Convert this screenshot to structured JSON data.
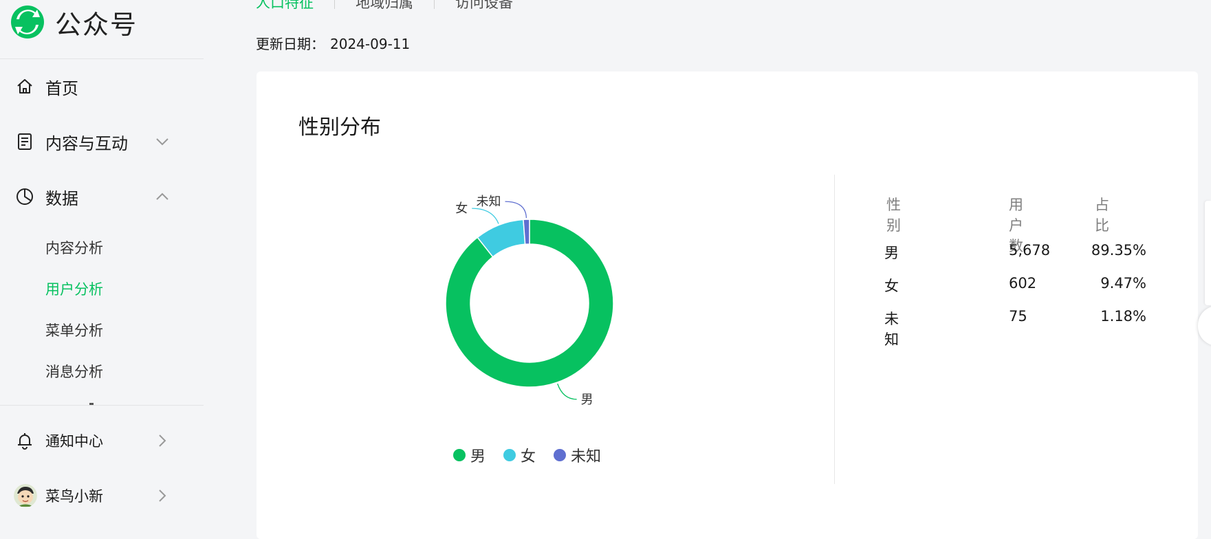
{
  "app": {
    "brand": "公众号",
    "brand_color": "#07c160"
  },
  "sidebar": {
    "items": [
      {
        "label": "首页",
        "icon": "home-icon"
      },
      {
        "label": "内容与互动",
        "icon": "document-icon",
        "chevron": "chevron-down-icon"
      },
      {
        "label": "数据",
        "icon": "pie-chart-icon",
        "chevron": "chevron-up-icon"
      }
    ],
    "sub_items": [
      {
        "label": "内容分析",
        "active": false
      },
      {
        "label": "用户分析",
        "active": true
      },
      {
        "label": "菜单分析",
        "active": false
      },
      {
        "label": "消息分析",
        "active": false
      }
    ],
    "bottom": [
      {
        "label": "通知中心",
        "icon": "bell-icon",
        "chevron": "chevron-right-icon"
      },
      {
        "label": "菜鸟小新",
        "icon": "avatar",
        "chevron": "chevron-right-icon"
      }
    ]
  },
  "tabs": [
    {
      "label": "人口特征",
      "active": true
    },
    {
      "label": "地域归属",
      "active": false
    },
    {
      "label": "访问设备",
      "active": false
    }
  ],
  "update": {
    "label": "更新日期：",
    "date": "2024-09-11"
  },
  "card": {
    "title": "性别分布"
  },
  "chart_data": {
    "type": "pie",
    "variant": "donut",
    "categories": [
      "男",
      "女",
      "未知"
    ],
    "values": [
      5678,
      602,
      75
    ],
    "percentages": [
      89.35,
      9.47,
      1.18
    ],
    "colors": [
      "#07c160",
      "#3fcbe1",
      "#5f6fd0"
    ],
    "legend": [
      "男",
      "女",
      "未知"
    ],
    "legend_position": "bottom"
  },
  "table": {
    "headers": [
      "性别",
      "用户数",
      "占比"
    ],
    "rows": [
      [
        "男",
        "5,678",
        "89.35%"
      ],
      [
        "女",
        "602",
        "9.47%"
      ],
      [
        "未知",
        "75",
        "1.18%"
      ]
    ]
  }
}
